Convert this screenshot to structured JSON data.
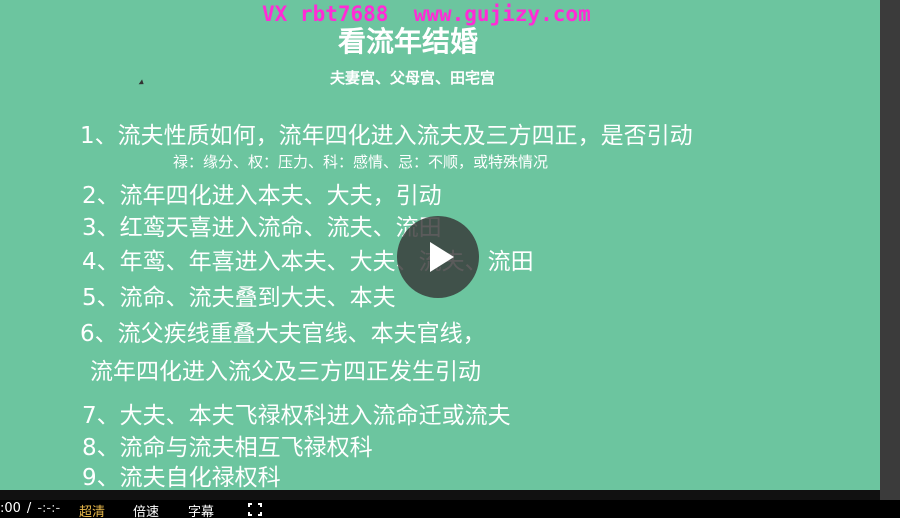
{
  "watermark": "VX rbt7688  www.gujizy.com",
  "slide": {
    "title": "看流年结婚",
    "subtitle": "夫妻宫、父母宫、田宅宫",
    "note": "禄：缘分、权：压力、科：感情、忌：不顺，或特殊情况",
    "items": [
      "1、流夫性质如何，流年四化进入流夫及三方四正，是否引动",
      "2、流年四化进入本夫、大夫，引动",
      "3、红鸾天喜进入流命、流夫、流田",
      "4、年鸾、年喜进入本夫、大夫、流夫、流田",
      "5、流命、流夫叠到大夫、本夫",
      "6、流父疾线重叠大夫官线、本夫官线，",
      "流年四化进入流父及三方四正发生引动",
      "7、大夫、本夫飞禄权科进入流命迁或流夫",
      "8、流命与流夫相互飞禄权科",
      "9、流夫自化禄权科"
    ]
  },
  "player": {
    "current_time": ":00",
    "separator": "/",
    "total_time": "-:-:-",
    "quality_label": "超清",
    "speed_label": "倍速",
    "subtitle_label": "字幕",
    "play_icon": "play-icon",
    "fullscreen_icon": "fullscreen-icon"
  },
  "colors": {
    "slide_background": "#6cc59f",
    "watermark": "#ff2bd6",
    "quality_accent": "#e8b84a"
  }
}
